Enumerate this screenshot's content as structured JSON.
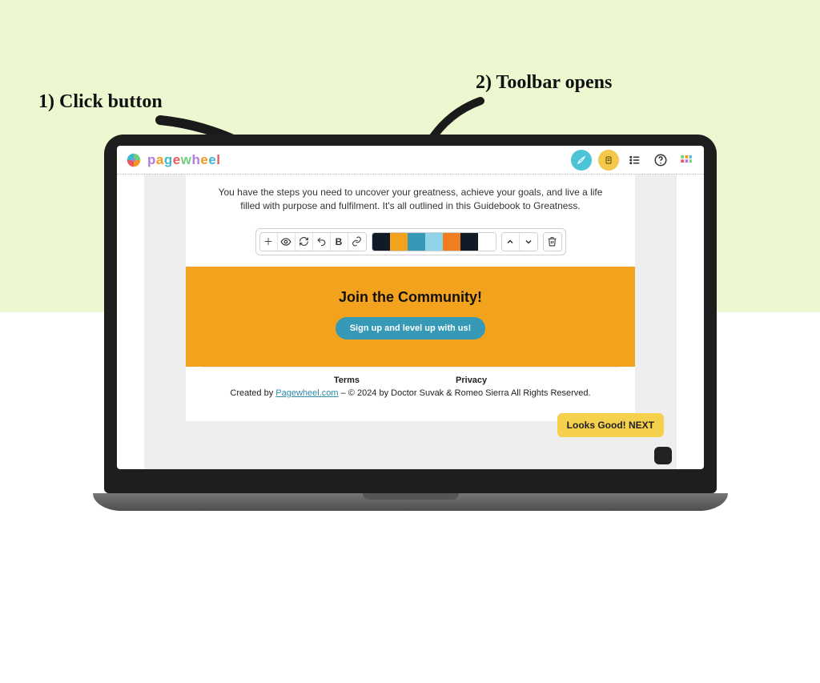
{
  "annotations": {
    "step1": "1) Click button",
    "step2": "2) Toolbar opens"
  },
  "header": {
    "brand": "pagewheel"
  },
  "intro": "You have the steps you need to uncover your greatness, achieve your goals, and live a life filled with purpose and fulfilment. It's all outlined in this Guidebook to Greatness.",
  "toolbar": {
    "swatches": [
      "#0f1b26",
      "#f3a21d",
      "#3699b6",
      "#8fd4e8",
      "#f07d1f",
      "#0f1b26",
      "#ffffff"
    ]
  },
  "cta": {
    "title": "Join the Community!",
    "button": "Sign up and level up with us!"
  },
  "footer": {
    "terms": "Terms",
    "privacy": "Privacy",
    "created_prefix": "Created by ",
    "created_link": "Pagewheel.com",
    "copyright": " – © 2024 by Doctor Suvak & Romeo Sierra All Rights Reserved."
  },
  "next_button": "Looks Good! NEXT"
}
